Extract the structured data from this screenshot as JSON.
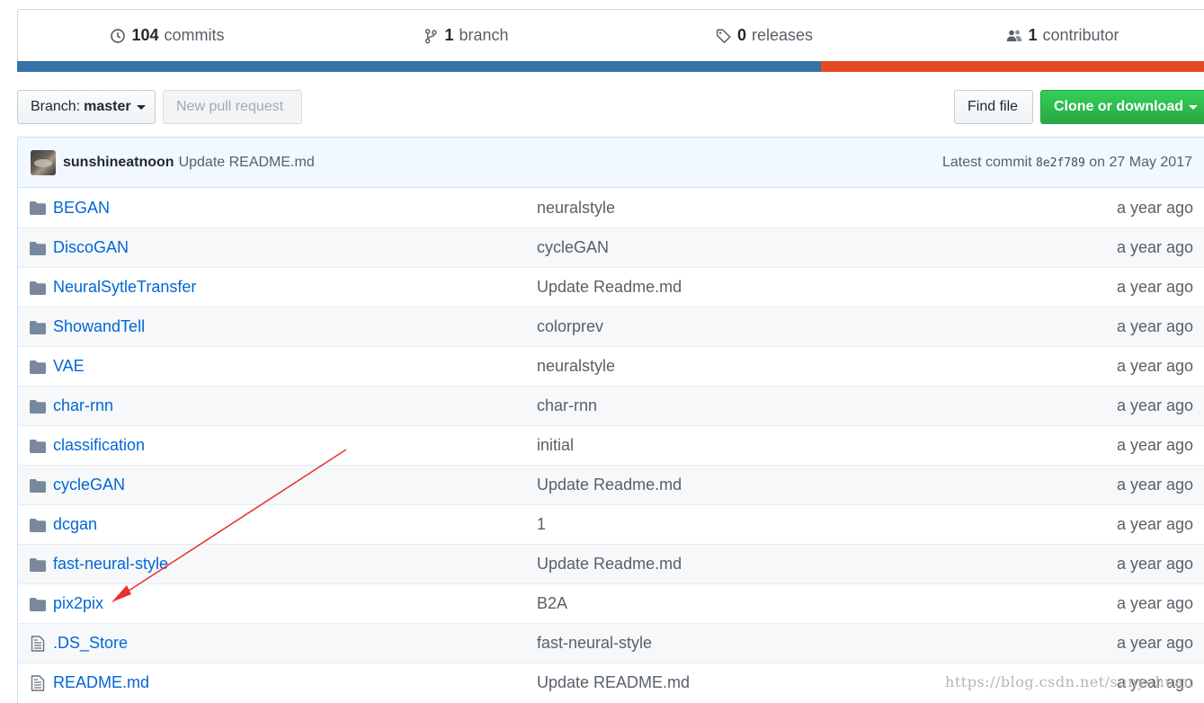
{
  "stats": {
    "commits": {
      "num": "104",
      "label": "commits",
      "icon": "history-icon"
    },
    "branches": {
      "num": "1",
      "label": "branch",
      "icon": "git-branch-icon"
    },
    "releases": {
      "num": "0",
      "label": "releases",
      "icon": "tag-icon"
    },
    "contributors": {
      "num": "1",
      "label": "contributor",
      "icon": "people-icon"
    }
  },
  "language_bar": {
    "colors": [
      "#3572A5",
      "#e44b23"
    ]
  },
  "toolbar": {
    "branch_label": "Branch:",
    "branch_value": "master",
    "new_pr": "New pull request",
    "find_file": "Find file",
    "clone": "Clone or download"
  },
  "commit": {
    "author": "sunshineatnoon",
    "message": "Update README.md",
    "latest_label": "Latest commit",
    "sha": "8e2f789",
    "date": "on 27 May 2017"
  },
  "files": [
    {
      "type": "dir",
      "name": "BEGAN",
      "message": "neuralstyle",
      "age": "a year ago"
    },
    {
      "type": "dir",
      "name": "DiscoGAN",
      "message": "cycleGAN",
      "age": "a year ago"
    },
    {
      "type": "dir",
      "name": "NeuralSytleTransfer",
      "message": "Update Readme.md",
      "age": "a year ago"
    },
    {
      "type": "dir",
      "name": "ShowandTell",
      "message": "colorprev",
      "age": "a year ago"
    },
    {
      "type": "dir",
      "name": "VAE",
      "message": "neuralstyle",
      "age": "a year ago"
    },
    {
      "type": "dir",
      "name": "char-rnn",
      "message": "char-rnn",
      "age": "a year ago"
    },
    {
      "type": "dir",
      "name": "classification",
      "message": "initial",
      "age": "a year ago"
    },
    {
      "type": "dir",
      "name": "cycleGAN",
      "message": "Update Readme.md",
      "age": "a year ago"
    },
    {
      "type": "dir",
      "name": "dcgan",
      "message": "1",
      "age": "a year ago"
    },
    {
      "type": "dir",
      "name": "fast-neural-style",
      "message": "Update Readme.md",
      "age": "a year ago"
    },
    {
      "type": "dir",
      "name": "pix2pix",
      "message": "B2A",
      "age": "a year ago"
    },
    {
      "type": "file",
      "name": ".DS_Store",
      "message": "fast-neural-style",
      "age": "a year ago"
    },
    {
      "type": "file",
      "name": "README.md",
      "message": "Update README.md",
      "age": "a year ago"
    }
  ],
  "watermark": "https://blog.csdn.net/sunyohuan",
  "annotation": {
    "color": "#e8312f"
  }
}
